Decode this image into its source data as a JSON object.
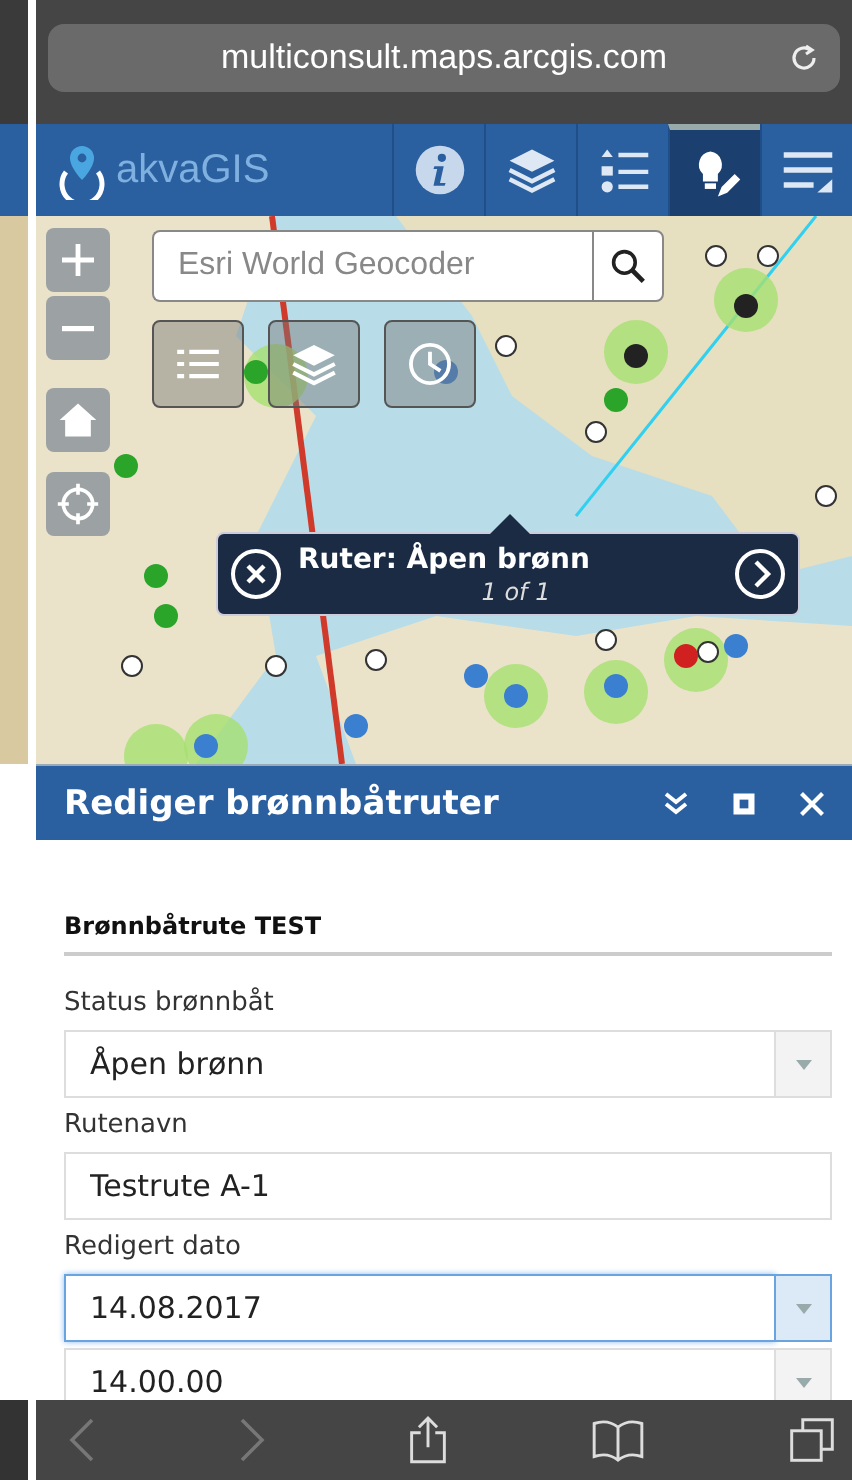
{
  "browser": {
    "url": "multiconsult.maps.arcgis.com"
  },
  "app_header": {
    "title": "akvaGIS",
    "tools": [
      {
        "kind": "info",
        "selected": false
      },
      {
        "kind": "layers",
        "selected": false
      },
      {
        "kind": "legend",
        "selected": false
      },
      {
        "kind": "edit",
        "selected": true
      },
      {
        "kind": "menu",
        "selected": false
      }
    ]
  },
  "map": {
    "search": {
      "placeholder": "Esri World Geocoder"
    },
    "popup": {
      "title": "Ruter: Åpen brønn",
      "count": "1 of 1"
    }
  },
  "panel": {
    "title": "Rediger brønnbåtruter",
    "form_title": "Brønnbåtrute TEST",
    "fields": [
      {
        "label": "Status brønnbåt",
        "value": "Åpen brønn",
        "kind": "select",
        "focused": false
      },
      {
        "label": "Rutenavn",
        "value": "Testrute A-1",
        "kind": "text",
        "focused": false
      },
      {
        "label": "Redigert dato",
        "value": "14.08.2017",
        "kind": "select",
        "focused": true
      },
      {
        "value": "14.00.00",
        "kind": "select",
        "focused": false
      }
    ]
  }
}
